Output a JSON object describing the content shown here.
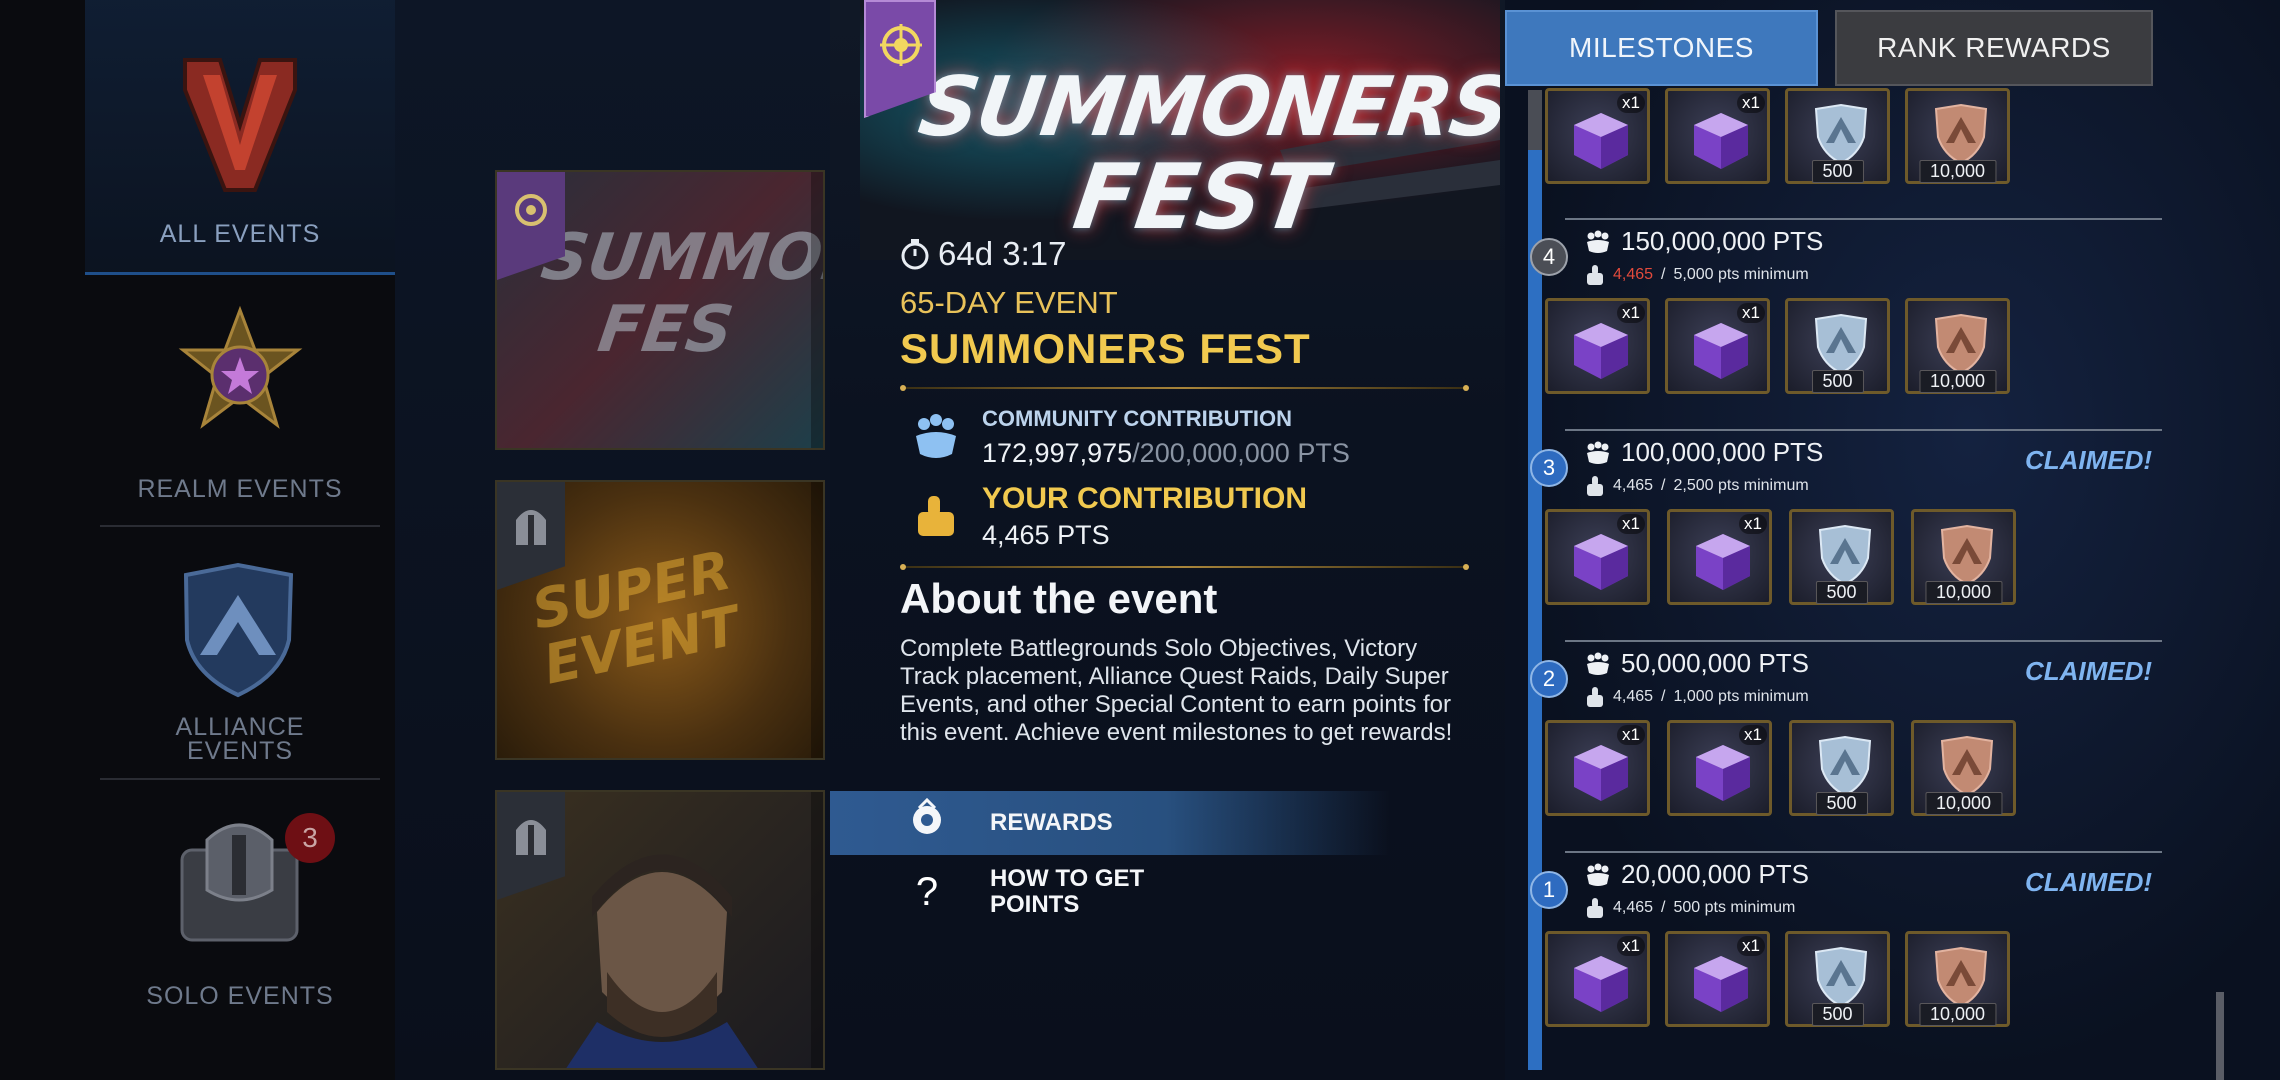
{
  "sidebar": {
    "items": [
      {
        "label": "ALL EVENTS"
      },
      {
        "label": "REALM EVENTS"
      },
      {
        "label": "ALLIANCE\nEVENTS"
      },
      {
        "label": "SOLO EVENTS",
        "badge": "3"
      }
    ]
  },
  "cards": [
    {
      "banner_text": "SUMMONERS FEST",
      "tag_icon": "summoner-emblem-icon"
    },
    {
      "banner_text": "SUPER EVENT",
      "tag_icon": "helmet-icon"
    },
    {
      "banner_text": "",
      "tag_icon": "helmet-icon"
    }
  ],
  "event": {
    "banner_logo_line1": "SUMMONERS",
    "banner_logo_line2": "FEST",
    "timer": "64d 3:17",
    "length": "65-DAY EVENT",
    "title": "SUMMONERS FEST",
    "community_label": "COMMUNITY CONTRIBUTION",
    "community_current": "172,997,975",
    "community_max": "200,000,000 PTS",
    "your_label": "YOUR CONTRIBUTION",
    "your_value": "4,465 PTS",
    "about_title": "About the event",
    "about_text": "Complete Battlegrounds Solo Objectives, Victory Track placement, Alliance Quest Raids, Daily Super Events, and other Special Content to earn points for this event. Achieve event milestones to get rewards!",
    "menu": [
      {
        "label": "REWARDS",
        "icon": "rewards-icon",
        "active": true
      },
      {
        "label": "HOW TO GET\nPOINTS",
        "icon": "question-icon",
        "active": false
      }
    ]
  },
  "tabs": {
    "milestones": "MILESTONES",
    "rank_rewards": "RANK REWARDS"
  },
  "tiers": [
    {
      "num": "4",
      "pts": "150,000,000 PTS",
      "current": "4,465",
      "min": "5,000 pts minimum",
      "claimed": "",
      "below_min": true
    },
    {
      "num": "3",
      "pts": "100,000,000 PTS",
      "current": "4,465",
      "min": "2,500 pts minimum",
      "claimed": "CLAIMED!",
      "below_min": false
    },
    {
      "num": "2",
      "pts": "50,000,000 PTS",
      "current": "4,465",
      "min": "1,000 pts minimum",
      "claimed": "CLAIMED!",
      "below_min": false
    },
    {
      "num": "1",
      "pts": "20,000,000 PTS",
      "current": "4,465",
      "min": "500 pts minimum",
      "claimed": "CLAIMED!",
      "below_min": false
    }
  ],
  "rewards": {
    "crate_qty": "x1",
    "silver_shield_value": "500",
    "bronze_shield_value": "10,000"
  },
  "colors": {
    "accent_blue": "#3e78bd",
    "gold": "#f1c94f",
    "claimed": "#7fb4f0",
    "below_min": "#e24a3c"
  }
}
